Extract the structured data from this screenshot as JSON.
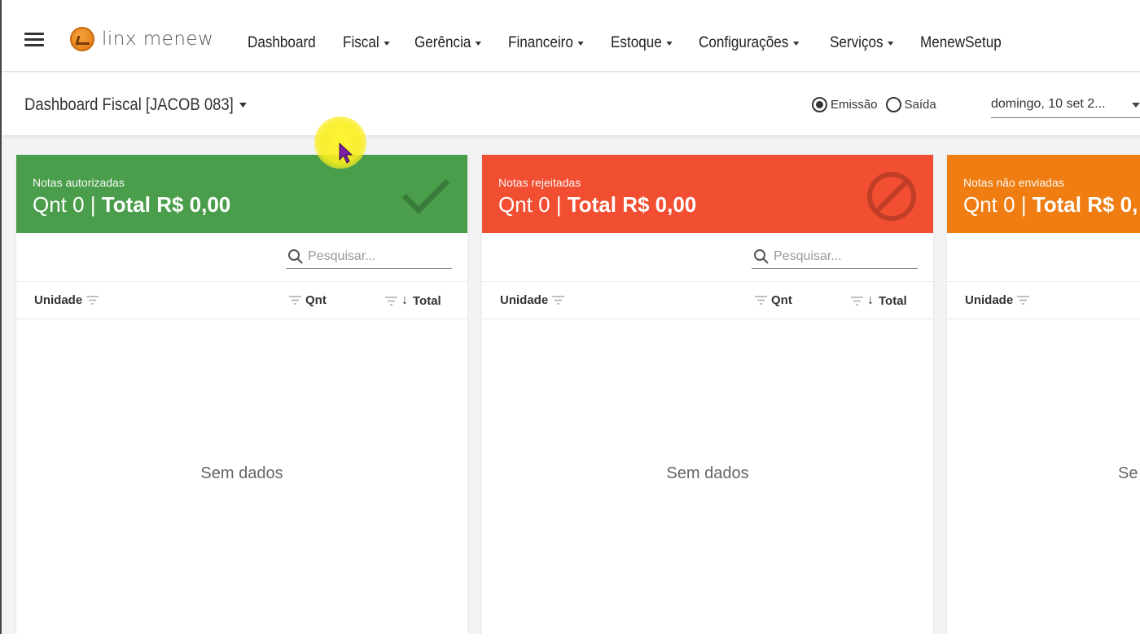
{
  "brand": {
    "name": "linx menew"
  },
  "menu": [
    {
      "label": "Dashboard",
      "dropdown": false
    },
    {
      "label": "Fiscal",
      "dropdown": true
    },
    {
      "label": "Gerência",
      "dropdown": true
    },
    {
      "label": "Financeiro",
      "dropdown": true
    },
    {
      "label": "Estoque",
      "dropdown": true
    },
    {
      "label": "Configurações",
      "dropdown": true
    },
    {
      "label": "Serviços",
      "dropdown": true
    },
    {
      "label": "MenewSetup",
      "dropdown": false
    }
  ],
  "subheader": {
    "title": "Dashboard Fiscal [JACOB 083]",
    "radio_emissao": "Emissão",
    "radio_saida": "Saída",
    "selected_radio": "Emissão",
    "date_value": "domingo, 10 set 2..."
  },
  "cards": [
    {
      "label": "Notas autorizadas",
      "qnt_text": "Qnt 0",
      "sep": " | ",
      "total_text": "Total R$ 0,00",
      "color": "#4a9e4b",
      "icon": "check-icon",
      "search_placeholder": "Pesquisar...",
      "col_unidade": "Unidade",
      "col_qnt": "Qnt",
      "col_total": "Total",
      "empty_text": "Sem dados"
    },
    {
      "label": "Notas rejeitadas",
      "qnt_text": "Qnt 0",
      "sep": " | ",
      "total_text": "Total R$ 0,00",
      "color": "#f24e32",
      "icon": "block-icon",
      "search_placeholder": "Pesquisar...",
      "col_unidade": "Unidade",
      "col_qnt": "Qnt",
      "col_total": "Total",
      "empty_text": "Sem dados"
    },
    {
      "label": "Notas não enviadas",
      "qnt_text": "Qnt 0",
      "sep": " | ",
      "total_text": "Total R$ 0,",
      "color": "#ef7d12",
      "icon": "",
      "search_placeholder": "",
      "col_unidade": "Unidade",
      "col_qnt": "",
      "col_total": "",
      "empty_text": "Se"
    }
  ]
}
